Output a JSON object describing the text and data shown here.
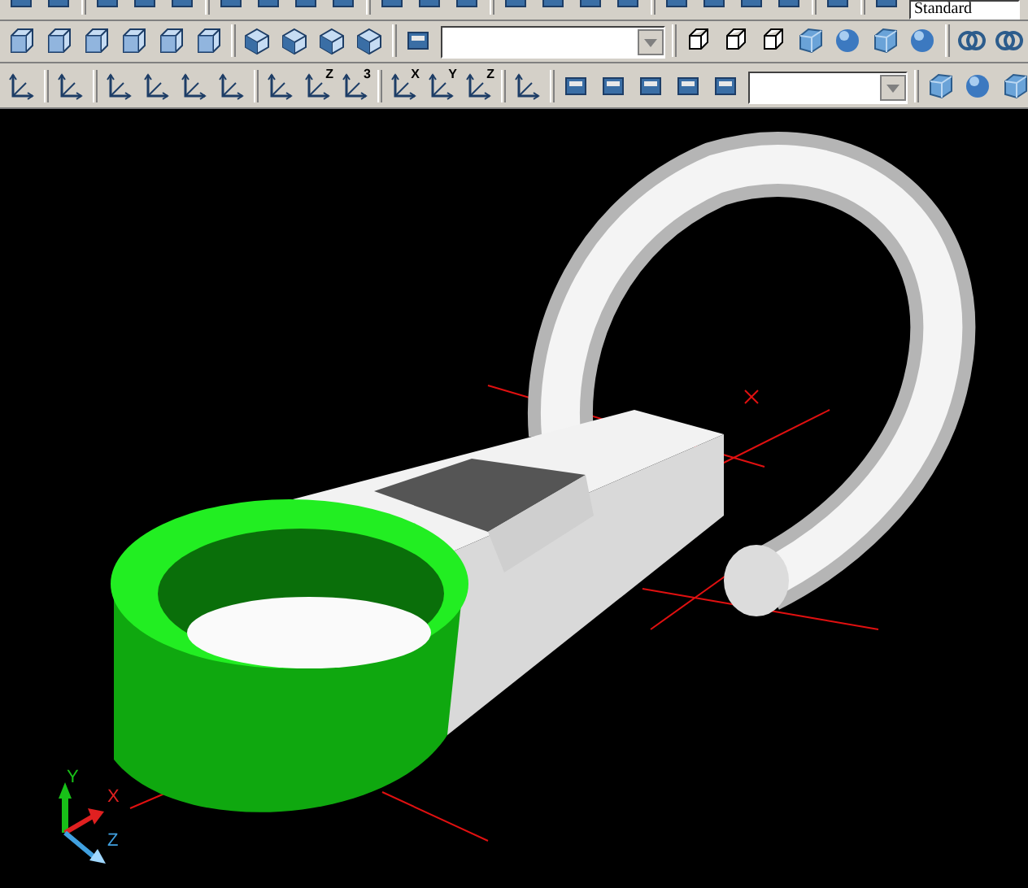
{
  "toolbars": [
    {
      "items": [
        {
          "kind": "tool"
        },
        {
          "kind": "tool"
        },
        {
          "kind": "sep"
        },
        {
          "kind": "tool"
        },
        {
          "kind": "tool"
        },
        {
          "kind": "tool"
        },
        {
          "kind": "sep"
        },
        {
          "kind": "tool"
        },
        {
          "kind": "tool"
        },
        {
          "kind": "tool"
        },
        {
          "kind": "tool"
        },
        {
          "kind": "sep"
        },
        {
          "kind": "tool"
        },
        {
          "kind": "tool"
        },
        {
          "kind": "tool"
        },
        {
          "kind": "sep"
        },
        {
          "kind": "tool"
        },
        {
          "kind": "tool"
        },
        {
          "kind": "tool"
        },
        {
          "kind": "tool"
        },
        {
          "kind": "sep"
        },
        {
          "kind": "tool"
        },
        {
          "kind": "tool"
        },
        {
          "kind": "tool"
        },
        {
          "kind": "tool"
        },
        {
          "kind": "sep"
        },
        {
          "kind": "tool"
        },
        {
          "kind": "sep"
        },
        {
          "kind": "tool"
        },
        {
          "kind": "dropdown",
          "value": "Standard"
        }
      ]
    },
    {
      "items": [
        {
          "kind": "cube"
        },
        {
          "kind": "cube"
        },
        {
          "kind": "cube"
        },
        {
          "kind": "cube"
        },
        {
          "kind": "cube"
        },
        {
          "kind": "cube"
        },
        {
          "kind": "sep"
        },
        {
          "kind": "iso"
        },
        {
          "kind": "iso"
        },
        {
          "kind": "iso"
        },
        {
          "kind": "iso"
        },
        {
          "kind": "sep"
        },
        {
          "kind": "tool"
        },
        {
          "kind": "dropdown"
        },
        {
          "kind": "sep"
        },
        {
          "kind": "wire"
        },
        {
          "kind": "wire"
        },
        {
          "kind": "wire"
        },
        {
          "kind": "solid"
        },
        {
          "kind": "sphere"
        },
        {
          "kind": "solid"
        },
        {
          "kind": "sphere"
        },
        {
          "kind": "sep"
        },
        {
          "kind": "ring"
        },
        {
          "kind": "ring"
        }
      ]
    },
    {
      "items": [
        {
          "kind": "ucs"
        },
        {
          "kind": "sep"
        },
        {
          "kind": "ucs"
        },
        {
          "kind": "sep"
        },
        {
          "kind": "ucs"
        },
        {
          "kind": "ucs"
        },
        {
          "kind": "ucs"
        },
        {
          "kind": "ucs"
        },
        {
          "kind": "sep"
        },
        {
          "kind": "ucs"
        },
        {
          "kind": "ucs",
          "letter": "Z"
        },
        {
          "kind": "ucs",
          "letter": "3"
        },
        {
          "kind": "sep"
        },
        {
          "kind": "ucs",
          "letter": "X"
        },
        {
          "kind": "ucs",
          "letter": "Y"
        },
        {
          "kind": "ucs",
          "letter": "Z"
        },
        {
          "kind": "sep"
        },
        {
          "kind": "ucs"
        },
        {
          "kind": "sep"
        },
        {
          "kind": "tool"
        },
        {
          "kind": "tool"
        },
        {
          "kind": "tool"
        },
        {
          "kind": "tool"
        },
        {
          "kind": "tool"
        },
        {
          "kind": "dropdown"
        },
        {
          "kind": "sep"
        },
        {
          "kind": "solid"
        },
        {
          "kind": "sphere"
        },
        {
          "kind": "solid"
        }
      ]
    }
  ],
  "viewport": {
    "ucs_icon": {
      "x_label": "X",
      "y_label": "Y",
      "z_label": "Z"
    }
  }
}
